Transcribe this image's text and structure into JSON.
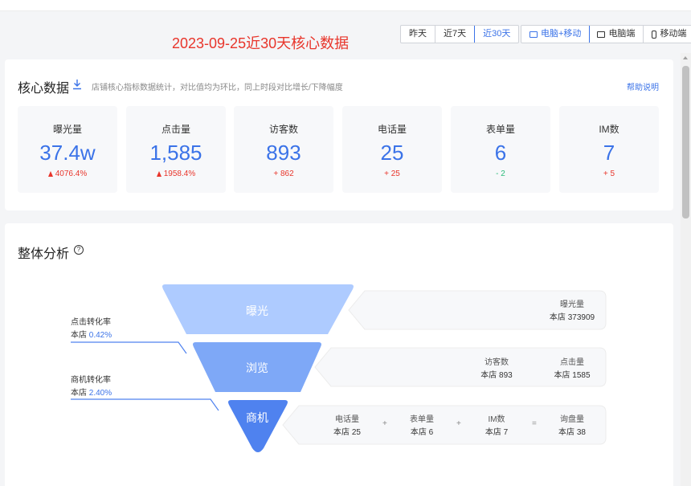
{
  "header": {
    "report_title": "2023-09-25近30天核心数据",
    "date_options": [
      "昨天",
      "近7天",
      "近30天"
    ],
    "date_selected": "近30天",
    "device_options": [
      "电脑+移动",
      "电脑端",
      "移动端"
    ],
    "device_selected": "电脑+移动"
  },
  "core": {
    "title": "核心数据",
    "description": "店铺核心指标数据统计，对比值均为环比，同上时段对比增长/下降幅度",
    "help": "帮助说明",
    "metrics": [
      {
        "label": "曝光量",
        "value": "37.4w",
        "change": "4076.4%",
        "trend": "up-arrow"
      },
      {
        "label": "点击量",
        "value": "1,585",
        "change": "1958.4%",
        "trend": "up-arrow"
      },
      {
        "label": "访客数",
        "value": "893",
        "change": "+ 862",
        "trend": "up"
      },
      {
        "label": "电话量",
        "value": "25",
        "change": "+ 25",
        "trend": "up"
      },
      {
        "label": "表单量",
        "value": "6",
        "change": "- 2",
        "trend": "down"
      },
      {
        "label": "IM数",
        "value": "7",
        "change": "+ 5",
        "trend": "up"
      }
    ]
  },
  "analysis": {
    "title": "整体分析",
    "help_icon_glyph": "?",
    "stages": [
      "曝光",
      "浏览",
      "商机"
    ],
    "click_rate": {
      "title": "点击转化率",
      "prefix": "本店",
      "value": "0.42%"
    },
    "biz_rate": {
      "title": "商机转化率",
      "prefix": "本店",
      "value": "2.40%"
    },
    "exposure_box": {
      "label": "曝光量",
      "value": "本店 373909"
    },
    "browse_box": [
      {
        "label": "访客数",
        "value": "本店 893"
      },
      {
        "label": "点击量",
        "value": "本店 1585"
      }
    ],
    "biz_box": [
      {
        "label": "电话量",
        "value": "本店 25"
      },
      {
        "label": "表单量",
        "value": "本店 6"
      },
      {
        "label": "IM数",
        "value": "本店 7"
      },
      {
        "label": "询盘量",
        "value": "本店 38"
      }
    ],
    "ops": [
      "+",
      "+",
      "="
    ]
  },
  "colors": {
    "accent": "#3b73e8",
    "up": "#e8352b",
    "down": "#2dbb7b",
    "stage1": "#aecbff",
    "stage2": "#7ea8f7",
    "stage3": "#4f82ef"
  }
}
